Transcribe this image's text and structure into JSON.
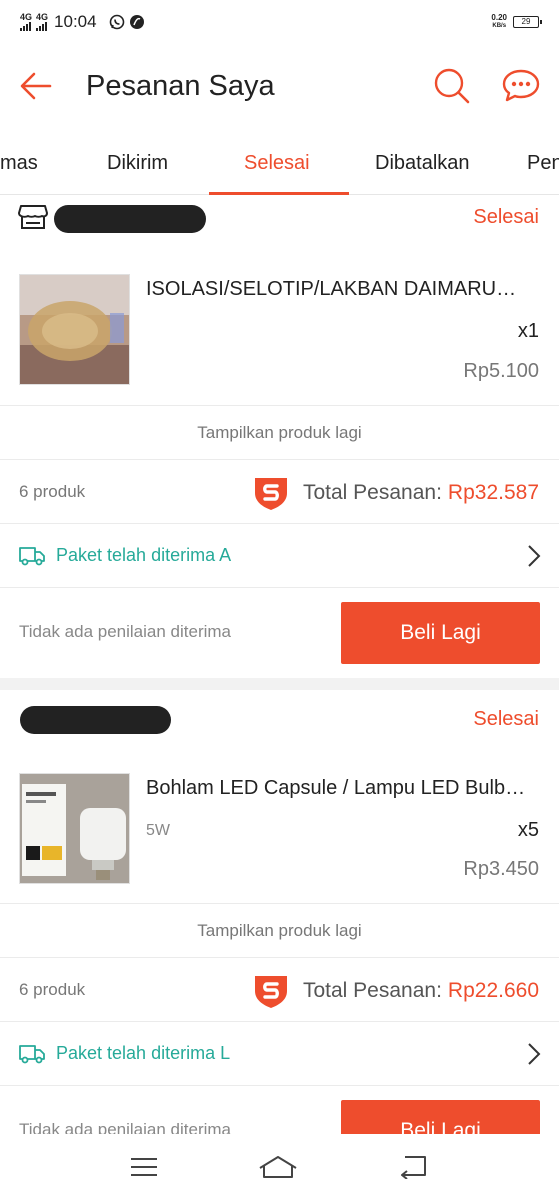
{
  "status_bar": {
    "network_1": "4G",
    "network_2": "4G",
    "time": "10:04",
    "speed_value": "0.20",
    "speed_unit": "KB/s",
    "battery": "29"
  },
  "header": {
    "title": "Pesanan Saya",
    "back_icon": "arrow-left-icon",
    "search_icon": "search-icon",
    "chat_icon": "chat-icon"
  },
  "tabs": [
    {
      "label": "mas"
    },
    {
      "label": "Dikirim"
    },
    {
      "label": "Selesai",
      "active": true
    },
    {
      "label": "Dibatalkan"
    },
    {
      "label": "Pen"
    }
  ],
  "orders": [
    {
      "status": "Selesai",
      "product_name": "ISOLASI/SELOTIP/LAKBAN DAIMARU…",
      "variant": "",
      "qty": "x1",
      "price": "Rp5.100",
      "more_label": "Tampilkan produk lagi",
      "count": "6 produk",
      "total_label": "Total Pesanan:",
      "total_amount": "Rp32.587",
      "shipping": "Paket telah diterima A",
      "rating_text": "Tidak ada penilaian diterima",
      "button": "Beli Lagi"
    },
    {
      "status": "Selesai",
      "product_name": "Bohlam LED Capsule / Lampu LED Bulb…",
      "variant": "5W",
      "qty": "x5",
      "price": "Rp3.450",
      "more_label": "Tampilkan produk lagi",
      "count": "6 produk",
      "total_label": "Total Pesanan:",
      "total_amount": "Rp22.660",
      "shipping": "Paket telah diterima L",
      "rating_text": "Tidak ada penilaian diterima",
      "button": "Beli Lagi"
    }
  ],
  "colors": {
    "accent": "#ee4d2d",
    "shipping": "#26aa99"
  }
}
